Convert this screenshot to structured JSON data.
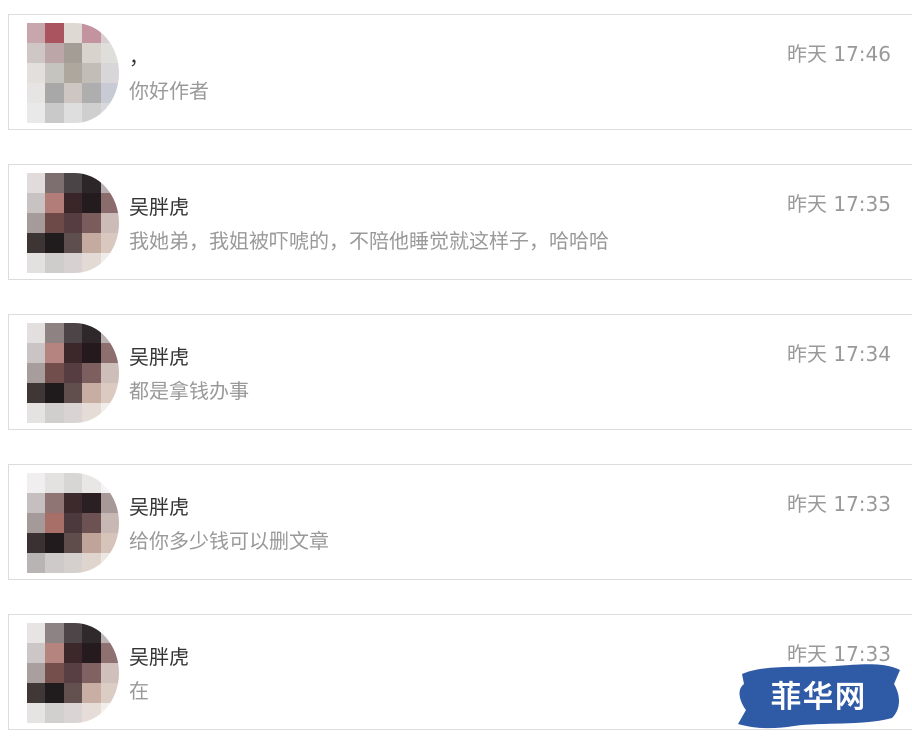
{
  "messages": [
    {
      "sender": "，",
      "time": "昨天 17:46",
      "preview": "你好作者",
      "avatar_colors": [
        "#c7a7ad",
        "#a9545f",
        "#dfd9d4",
        "#c393a0",
        "#d9cdd1",
        "#cfc6c6",
        "#bca6a8",
        "#a49d95",
        "#d8d3cc",
        "#e0dedb",
        "#e2dfdc",
        "#c6c4be",
        "#aea79e",
        "#c2bdb7",
        "#d8d6d8",
        "#e7e5e4",
        "#a8a8a8",
        "#cdc6c3",
        "#aeaeae",
        "#c9cbd4",
        "#e9e9e9",
        "#c9c9c9",
        "#dedede",
        "#cfcfcf",
        "#d9d9dd"
      ]
    },
    {
      "sender": "吴胖虎",
      "time": "昨天 17:35",
      "preview": "我她弟，我姐被吓唬的，不陪他睡觉就这样子，哈哈哈",
      "avatar_colors": [
        "#e1dcdb",
        "#7d6f70",
        "#4b4446",
        "#2d2629",
        "#b6aeb0",
        "#c9c2c3",
        "#b27d79",
        "#3a2629",
        "#231b1e",
        "#8b6c6c",
        "#a49b9a",
        "#6d4a48",
        "#563d41",
        "#7b5c5c",
        "#cbbcb8",
        "#3d3434",
        "#201b1d",
        "#5e4e4d",
        "#c4aa9f",
        "#d8c8c0",
        "#e3e0e0",
        "#cfcccc",
        "#d7d2d1",
        "#e4dad5",
        "#f0ecea"
      ]
    },
    {
      "sender": "吴胖虎",
      "time": "昨天 17:34",
      "preview": "都是拿钱办事",
      "avatar_colors": [
        "#e3dfdf",
        "#8e8282",
        "#4d4447",
        "#2f282b",
        "#b8b0b1",
        "#cbc4c5",
        "#b58380",
        "#3c272a",
        "#241a1e",
        "#8e6f70",
        "#a69d9c",
        "#714d4b",
        "#553d41",
        "#7e5f60",
        "#cdbeba",
        "#3f3636",
        "#1f1a1c",
        "#614f4d",
        "#c7ad a2",
        "#dacac2",
        "#e5e2e2",
        "#d1cece",
        "#d9d4d3",
        "#e6dcd7",
        "#f1edeb"
      ]
    },
    {
      "sender": "吴胖虎",
      "time": "昨天 17:33",
      "preview": "给你多少钱可以删文章",
      "avatar_colors": [
        "#f0eeee",
        "#e4e1e1",
        "#d8d5d5",
        "#e9e6e6",
        "#f5f3f3",
        "#c6bfc0",
        "#8f7574",
        "#3d2a2d",
        "#2a1f22",
        "#a99898",
        "#a39a99",
        "#a86f69",
        "#4c393d",
        "#6c5253",
        "#c8b8b3",
        "#3a3232",
        "#211b1d",
        "#5f4d4b",
        "#c0a49a",
        "#d6c4bb",
        "#b9b4b4",
        "#cfcaca",
        "#d5cfce",
        "#e0d4ce",
        "#ede7e4"
      ]
    },
    {
      "sender": "吴胖虎",
      "time": "昨天 17:33",
      "preview": "在",
      "avatar_colors": [
        "#e8e4e4",
        "#8e8384",
        "#4e4548",
        "#30292c",
        "#bbb3b4",
        "#cdc6c7",
        "#b5847f",
        "#3c282b",
        "#251b1f",
        "#907172",
        "#a89f9e",
        "#744f4c",
        "#573f43",
        "#816262",
        "#cfc0bb",
        "#403737",
        "#201b1d",
        "#635150",
        "#c8aea3",
        "#dbccc4",
        "#e6e3e3",
        "#d2cfcf",
        "#dad5d4",
        "#e7ddd8",
        "#f2eeec"
      ]
    }
  ],
  "watermark": {
    "text": "菲华网",
    "color": "#2f5aa6"
  }
}
